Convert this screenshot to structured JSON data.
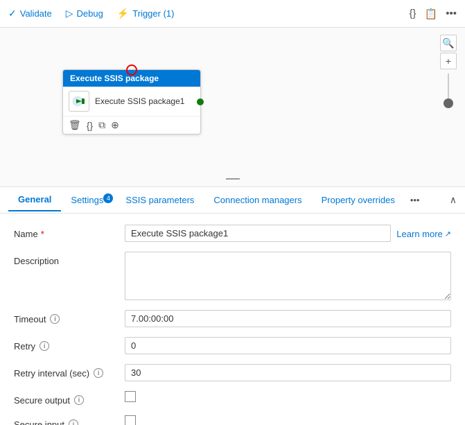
{
  "toolbar": {
    "validate_label": "Validate",
    "debug_label": "Debug",
    "trigger_label": "Trigger (1)"
  },
  "canvas": {
    "node": {
      "header": "Execute SSIS package",
      "label": "Execute SSIS package1",
      "toolbar_icons": [
        "delete",
        "code",
        "copy",
        "navigate"
      ]
    }
  },
  "tabs": [
    {
      "id": "general",
      "label": "General",
      "badge": null,
      "active": true
    },
    {
      "id": "settings",
      "label": "Settings",
      "badge": "4",
      "active": false
    },
    {
      "id": "ssis-parameters",
      "label": "SSIS parameters",
      "badge": null,
      "active": false
    },
    {
      "id": "connection-managers",
      "label": "Connection managers",
      "badge": null,
      "active": false
    },
    {
      "id": "property-overrides",
      "label": "Property overrides",
      "badge": null,
      "active": false
    }
  ],
  "form": {
    "name_label": "Name",
    "name_value": "Execute SSIS package1",
    "learn_more_label": "Learn more",
    "description_label": "Description",
    "description_placeholder": "",
    "timeout_label": "Timeout",
    "timeout_value": "7.00:00:00",
    "retry_label": "Retry",
    "retry_value": "0",
    "retry_interval_label": "Retry interval (sec)",
    "retry_interval_value": "30",
    "secure_output_label": "Secure output",
    "secure_input_label": "Secure input"
  }
}
